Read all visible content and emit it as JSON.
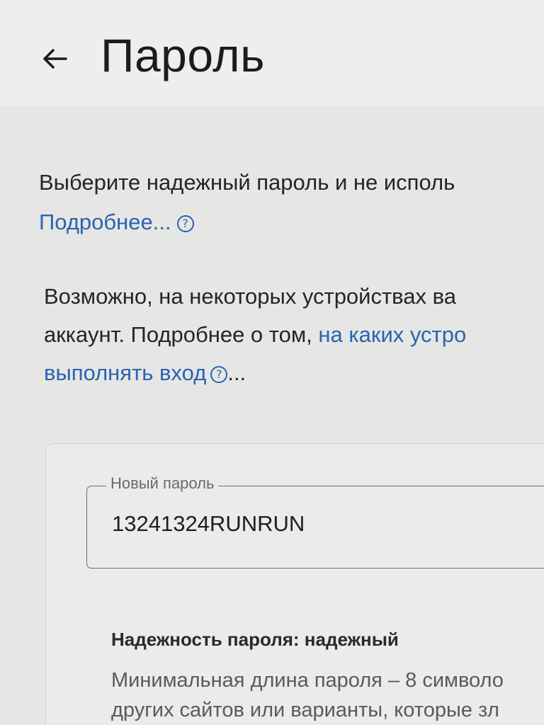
{
  "header": {
    "back_icon": "arrow-back-icon",
    "title": "Пароль"
  },
  "intro": {
    "text": "Выберите надежный пароль и не исполь",
    "learn_more_link": "Подробнее...",
    "help_icon": "help-circle-icon"
  },
  "devices_notice": {
    "line1": "Возможно, на некоторых устройствах ва",
    "line2_prefix": "аккаунт. Подробнее о том, ",
    "link_part1": "на каких устро",
    "link_part2": "выполнять вход",
    "help_icon": "help-circle-icon",
    "suffix": "..."
  },
  "password_card": {
    "field_label": "Новый пароль",
    "field_value": "13241324RUNRUN",
    "strength": "Надежность пароля: надежный",
    "requirements_line1": "Минимальная длина пароля – 8 символо",
    "requirements_line2": "других сайтов или варианты, которые зл"
  },
  "colors": {
    "link": "#2a63b2",
    "background": "#e6e6e4",
    "text": "#252525"
  }
}
